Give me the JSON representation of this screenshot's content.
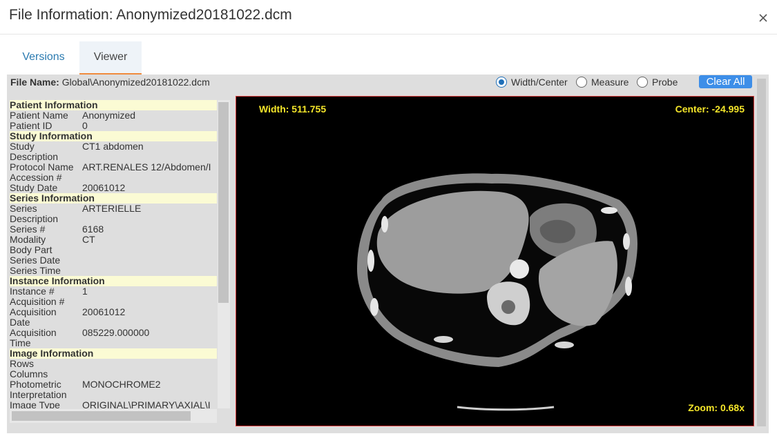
{
  "dialog": {
    "title": "File Information: Anonymized20181022.dcm",
    "close_icon": "×"
  },
  "tabs": [
    {
      "label": "Versions",
      "active": false
    },
    {
      "label": "Viewer",
      "active": true
    }
  ],
  "file": {
    "label": "File Name:",
    "value": "Global\\Anonymized20181022.dcm"
  },
  "tools": {
    "width_center": "Width/Center",
    "measure": "Measure",
    "probe": "Probe",
    "selected": "Width/Center",
    "clear_all": "Clear All"
  },
  "info": {
    "patient_header": "Patient Information",
    "patient_name_k": "Patient Name",
    "patient_name_v": "Anonymized",
    "patient_id_k": "Patient ID",
    "patient_id_v": "0",
    "study_header": "Study Information",
    "study_desc_k": "Study",
    "study_desc_k2": "Description",
    "study_desc_v": "CT1 abdomen",
    "protocol_k": "Protocol Name",
    "protocol_v": "ART.RENALES 12/Abdomen/I",
    "accession_k": "Accession #",
    "accession_v": "",
    "study_date_k": "Study Date",
    "study_date_v": "20061012",
    "series_header": "Series Information",
    "series_desc_k": "Series",
    "series_desc_k2": "Description",
    "series_desc_v": "ARTERIELLE",
    "series_num_k": "Series #",
    "series_num_v": "6168",
    "modality_k": "Modality",
    "modality_v": "CT",
    "body_part_k": "Body Part",
    "body_part_v": "",
    "series_date_k": "Series Date",
    "series_date_v": "",
    "series_time_k": "Series Time",
    "series_time_v": "",
    "instance_header": "Instance Information",
    "instance_num_k": "Instance #",
    "instance_num_v": "1",
    "acq_num_k": "Acquisition #",
    "acq_num_v": "",
    "acq_date_k": "Acquisition",
    "acq_date_k2": "Date",
    "acq_date_v": "20061012",
    "acq_time_k": "Acquisition",
    "acq_time_k2": "Time",
    "acq_time_v": "085229.000000",
    "image_header": "Image Information",
    "rows_k": "Rows",
    "rows_v": "",
    "columns_k": "Columns",
    "columns_v": "",
    "photometric_k": "Photometric",
    "photometric_k2": "Interpretation",
    "photometric_v": "MONOCHROME2",
    "image_type_k": "Image Type",
    "image_type_v": "ORIGINAL\\PRIMARY\\AXIAL\\I"
  },
  "viewer": {
    "width_text": "Width: 511.755",
    "center_text": "Center: -24.995",
    "zoom_text": "Zoom: 0.68x"
  },
  "colors": {
    "accent": "#1f6fb8",
    "overlay_text": "#f5e62a",
    "section_bg": "#fbfbd4",
    "clear_button": "#3d8ee8",
    "viewer_border": "#e04040"
  }
}
